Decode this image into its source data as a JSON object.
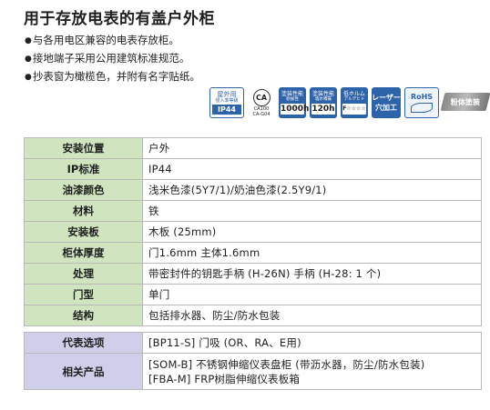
{
  "title": "用于存放电表的有盖户外柜",
  "bullets": [
    "与各用电区兼容的电表存放柜。",
    "接地端子采用公用建筑标准规范。",
    "抄表窗为橄榄色，并附有名字贴纸。"
  ],
  "badges": {
    "ip": {
      "top": "屋外用",
      "sub": "侵入率等級",
      "main": "IP44"
    },
    "ca": {
      "mark": "CA",
      "line1": "CA100",
      "line2": "CA-G04"
    },
    "weather": {
      "t1": "塗装性能",
      "t2": "耐候性",
      "value": "1000h"
    },
    "salt": {
      "t1": "塗装性能",
      "t2": "塩水噴霧",
      "value": "120h"
    },
    "formaldehyde": {
      "t1": "低ホルム",
      "t2": "アルデヒド",
      "value": "F☆☆☆☆"
    },
    "laser": {
      "line1": "レーザー",
      "line2": "穴加工"
    },
    "rohs": {
      "label": "RoHS"
    },
    "powder": {
      "label": "粉体塗装"
    }
  },
  "spec_table": [
    {
      "label": "安装位置",
      "value": "户外"
    },
    {
      "label": "IP标准",
      "value": "IP44"
    },
    {
      "label": "油漆颜色",
      "value": "浅米色漆(5Y7/1)/奶油色漆(2.5Y9/1)"
    },
    {
      "label": "材料",
      "value": "铁"
    },
    {
      "label": "安装板",
      "value": "木板 (25mm)"
    },
    {
      "label": "柜体厚度",
      "value": "门1.6mm 主体1.6mm"
    },
    {
      "label": "处理",
      "value": "带密封件的钥匙手柄 (H-26N) 手柄 (H-28: 1 个)"
    },
    {
      "label": "门型",
      "value": "单门"
    },
    {
      "label": "结构",
      "value": "包括排水器、防尘/防水包装"
    }
  ],
  "option_table": {
    "options": {
      "label": "代表选项",
      "value": "[BP11-S] 门吸 (OR、RA、E用)"
    },
    "related": {
      "label": "相关产品",
      "lines": [
        "[SOM-B] 不锈钢伸缩仪表盘柜 (带沥水器，防尘/防水包装)",
        "[FBA-M] FRP树脂伸缩仪表板箱"
      ]
    }
  }
}
